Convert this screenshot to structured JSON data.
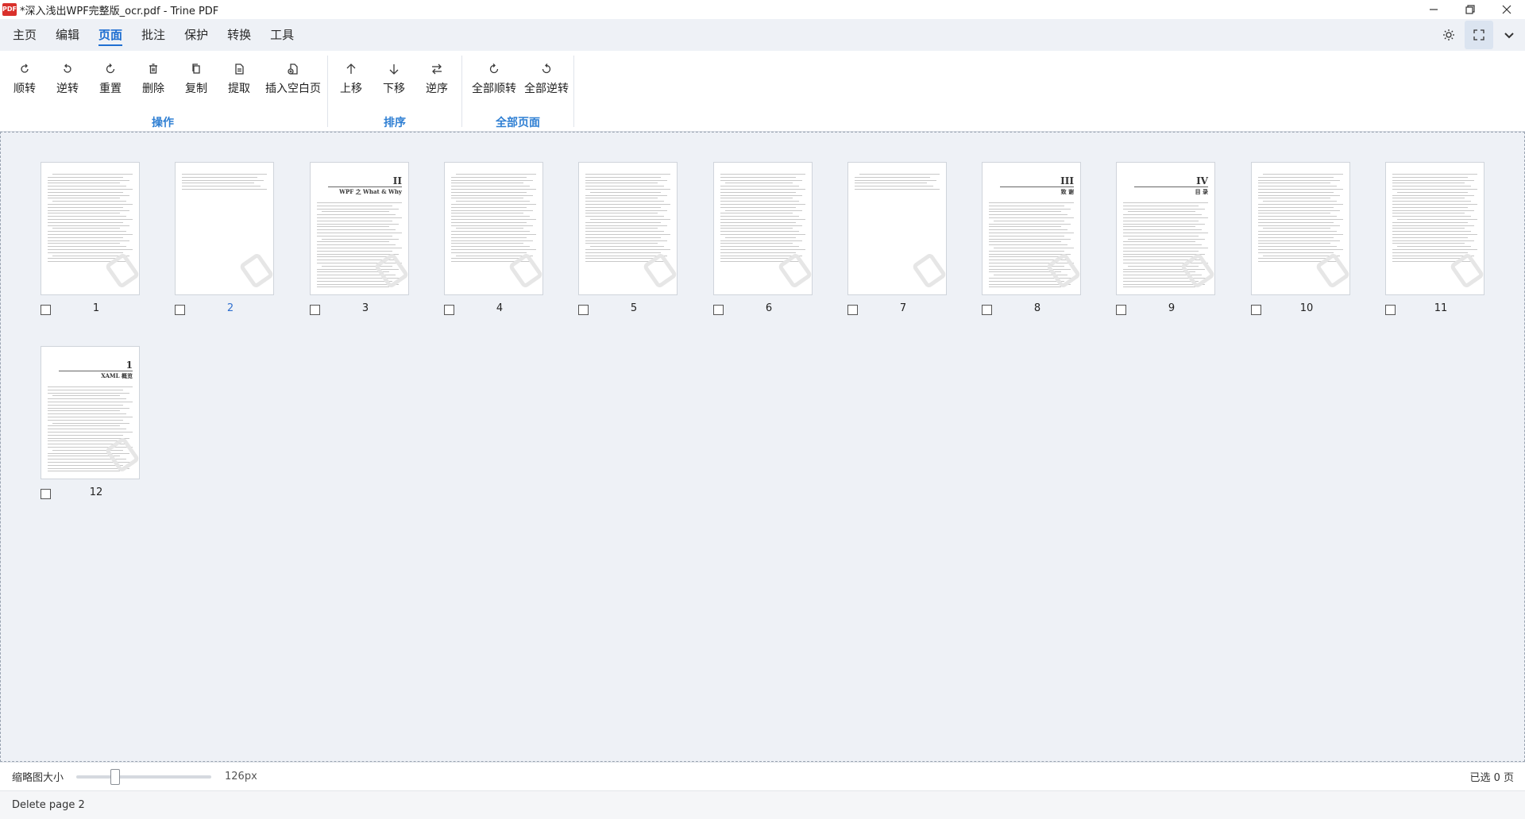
{
  "window": {
    "app_icon": "PDF",
    "title": "*深入浅出WPF完整版_ocr.pdf - Trine PDF"
  },
  "menu": {
    "tabs": [
      {
        "label": "主页"
      },
      {
        "label": "编辑"
      },
      {
        "label": "页面",
        "active": true
      },
      {
        "label": "批注"
      },
      {
        "label": "保护"
      },
      {
        "label": "转换"
      },
      {
        "label": "工具"
      }
    ]
  },
  "ribbon": {
    "groups": [
      {
        "label": "操作",
        "buttons": [
          {
            "label": "顺转",
            "icon": "rotate-cw-icon"
          },
          {
            "label": "逆转",
            "icon": "rotate-ccw-icon"
          },
          {
            "label": "重置",
            "icon": "reset-icon"
          },
          {
            "label": "删除",
            "icon": "trash-icon"
          },
          {
            "label": "复制",
            "icon": "copy-icon"
          },
          {
            "label": "提取",
            "icon": "extract-icon"
          },
          {
            "label": "插入空白页",
            "icon": "insert-page-icon"
          }
        ]
      },
      {
        "label": "排序",
        "buttons": [
          {
            "label": "上移",
            "icon": "arrow-up-icon"
          },
          {
            "label": "下移",
            "icon": "arrow-down-icon"
          },
          {
            "label": "逆序",
            "icon": "swap-icon"
          }
        ]
      },
      {
        "label": "全部页面",
        "buttons": [
          {
            "label": "全部顺转",
            "icon": "rotate-all-cw-icon"
          },
          {
            "label": "全部逆转",
            "icon": "rotate-all-ccw-icon"
          }
        ]
      }
    ]
  },
  "pages": [
    {
      "num": "1",
      "headings": []
    },
    {
      "num": "2",
      "headings": [],
      "highlighted": true
    },
    {
      "num": "3",
      "headings": [
        "II",
        "WPF 之 What & Why"
      ]
    },
    {
      "num": "4",
      "headings": []
    },
    {
      "num": "5",
      "headings": []
    },
    {
      "num": "6",
      "headings": []
    },
    {
      "num": "7",
      "headings": []
    },
    {
      "num": "8",
      "headings": [
        "III",
        "致 谢"
      ]
    },
    {
      "num": "9",
      "headings": [
        "IV",
        "目 录"
      ]
    },
    {
      "num": "10",
      "headings": []
    },
    {
      "num": "11",
      "headings": []
    },
    {
      "num": "12",
      "headings": [
        "1",
        "XAML 概览"
      ]
    }
  ],
  "bottom": {
    "thumb_size_label": "缩略图大小",
    "thumb_size_value": "126px",
    "slider_fraction": 0.25,
    "selected_count": "已选 0 页"
  },
  "status": {
    "message": "Delete page 2"
  },
  "colors": {
    "accent": "#1f6fd1",
    "group_label": "#2f7fd3",
    "workspace_bg": "#eef1f6"
  }
}
